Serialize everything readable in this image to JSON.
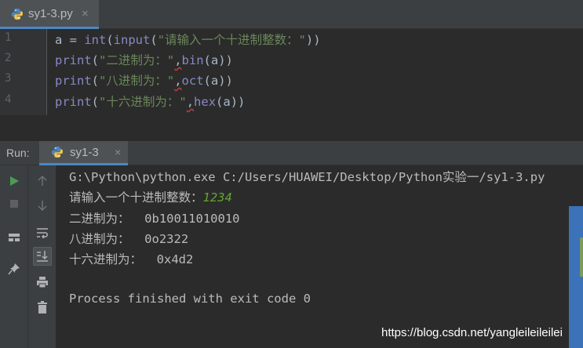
{
  "editor_tab": {
    "title": "sy1-3.py",
    "close": "×"
  },
  "gutter": {
    "lines": [
      "1",
      "2",
      "3",
      "4"
    ]
  },
  "code": [
    {
      "t1": "a = ",
      "f1": "int",
      "t2": "(",
      "f2": "input",
      "t3": "(",
      "s1": "\"请输入一个十进制整数：\"",
      "t4": "))"
    },
    {
      "f1": "print",
      "t1": "(",
      "s1": "\"二进制为：\"",
      "sep": ",",
      "f2": "bin",
      "t2": "(a))"
    },
    {
      "f1": "print",
      "t1": "(",
      "s1": "\"八进制为：\"",
      "sep": ",",
      "f2": "oct",
      "t2": "(a))"
    },
    {
      "f1": "print",
      "t1": "(",
      "s1": "\"十六进制为：\"",
      "sep": ",",
      "f2": "hex",
      "t2": "(a))"
    }
  ],
  "run_panel": {
    "label": "Run:",
    "tab_title": "sy1-3",
    "close": "×"
  },
  "console": {
    "command": "G:\\Python\\python.exe C:/Users/HUAWEI/Desktop/Python实验一/sy1-3.py",
    "prompt": "请输入一个十进制整数：",
    "user_input": "1234",
    "bin_line": "二进制为：  0b10011010010",
    "oct_line": "八进制为：  0o2322",
    "hex_line": "十六进制为：  0x4d2",
    "finished": "Process finished with exit code 0"
  },
  "watermark": "https://blog.csdn.net/yangleileileilei",
  "colors": {
    "background": "#2b2b2b",
    "tool_panel": "#3c3f41",
    "keyword_builtin": "#8888c6",
    "string": "#6a8759",
    "user_input": "#62a62b",
    "run_green": "#499c54",
    "tab_underline": "#4a88c7"
  },
  "icons": [
    "python-file-icon",
    "run-icon",
    "stop-icon",
    "layout-icon",
    "pin-icon",
    "up-arrow-icon",
    "down-arrow-icon",
    "soft-wrap-icon",
    "scroll-to-end-icon",
    "print-icon",
    "trash-icon"
  ]
}
